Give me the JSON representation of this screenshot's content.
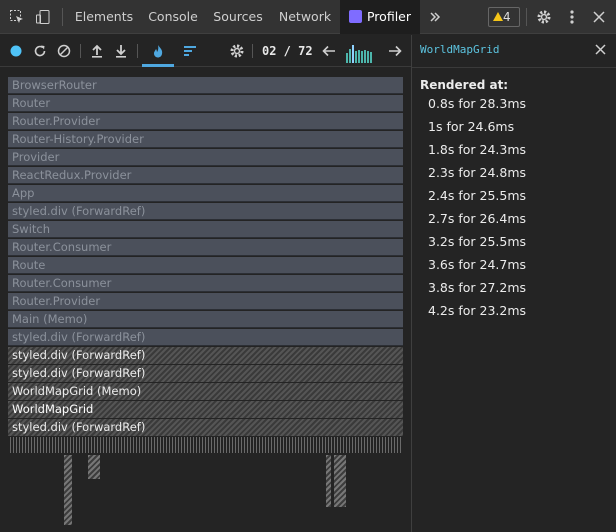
{
  "devtools": {
    "tabs": [
      {
        "label": "Elements"
      },
      {
        "label": "Console"
      },
      {
        "label": "Sources"
      },
      {
        "label": "Network"
      },
      {
        "label": "Profiler",
        "active": true
      }
    ],
    "more_tabs_icon": "chevron-double-right-icon",
    "warnings_count": "4",
    "icons": [
      "inspect-element-icon",
      "device-toolbar-icon",
      "gear-icon",
      "more-vertical-icon"
    ]
  },
  "profiler": {
    "toolbar_icons": [
      "record-icon",
      "reload-icon",
      "clear-icon",
      "load-profile-icon",
      "save-profile-icon",
      "flamegraph-icon",
      "ranked-chart-icon",
      "settings-icon",
      "prev-commit-icon",
      "next-commit-icon"
    ],
    "commit_counter": "02 / 72",
    "flamegraph_rows": [
      {
        "label": "BrowserRouter",
        "state": "dim"
      },
      {
        "label": "Router",
        "state": "dim"
      },
      {
        "label": "Router.Provider",
        "state": "dim"
      },
      {
        "label": "Router-History.Provider",
        "state": "dim"
      },
      {
        "label": "Provider",
        "state": "dim"
      },
      {
        "label": "ReactRedux.Provider",
        "state": "dim"
      },
      {
        "label": "App",
        "state": "dim"
      },
      {
        "label": "styled.div (ForwardRef)",
        "state": "dim"
      },
      {
        "label": "Switch",
        "state": "dim"
      },
      {
        "label": "Router.Consumer",
        "state": "dim"
      },
      {
        "label": "Route",
        "state": "dim"
      },
      {
        "label": "Router.Consumer",
        "state": "dim"
      },
      {
        "label": "Router.Provider",
        "state": "dim"
      },
      {
        "label": "Main (Memo)",
        "state": "dim"
      },
      {
        "label": "styled.div (ForwardRef)",
        "state": "dim"
      },
      {
        "label": "styled.div (ForwardRef)",
        "state": "hot"
      },
      {
        "label": "styled.div (ForwardRef)",
        "state": "hot"
      },
      {
        "label": "WorldMapGrid (Memo)",
        "state": "hot"
      },
      {
        "label": "WorldMapGrid",
        "state": "selected"
      },
      {
        "label": "styled.div (ForwardRef)",
        "state": "hot"
      }
    ]
  },
  "details": {
    "selected_component": "WorldMapGrid",
    "close_icon": "close-icon",
    "rendered_at_label": "Rendered at:",
    "renders": [
      "0.8s for 28.3ms",
      "1s for 24.6ms",
      "1.8s for 24.3ms",
      "2.3s for 24.8ms",
      "2.4s for 25.5ms",
      "2.7s for 26.4ms",
      "3.2s for 25.5ms",
      "3.6s for 24.7ms",
      "3.8s for 27.2ms",
      "4.2s for 23.2ms"
    ]
  },
  "colors": {
    "accent": "#4fa8e0",
    "record": "#4fc3f7",
    "component_name": "#5cc4e0",
    "commit_bar": "#4db6ac",
    "warning": "#f5c518"
  }
}
